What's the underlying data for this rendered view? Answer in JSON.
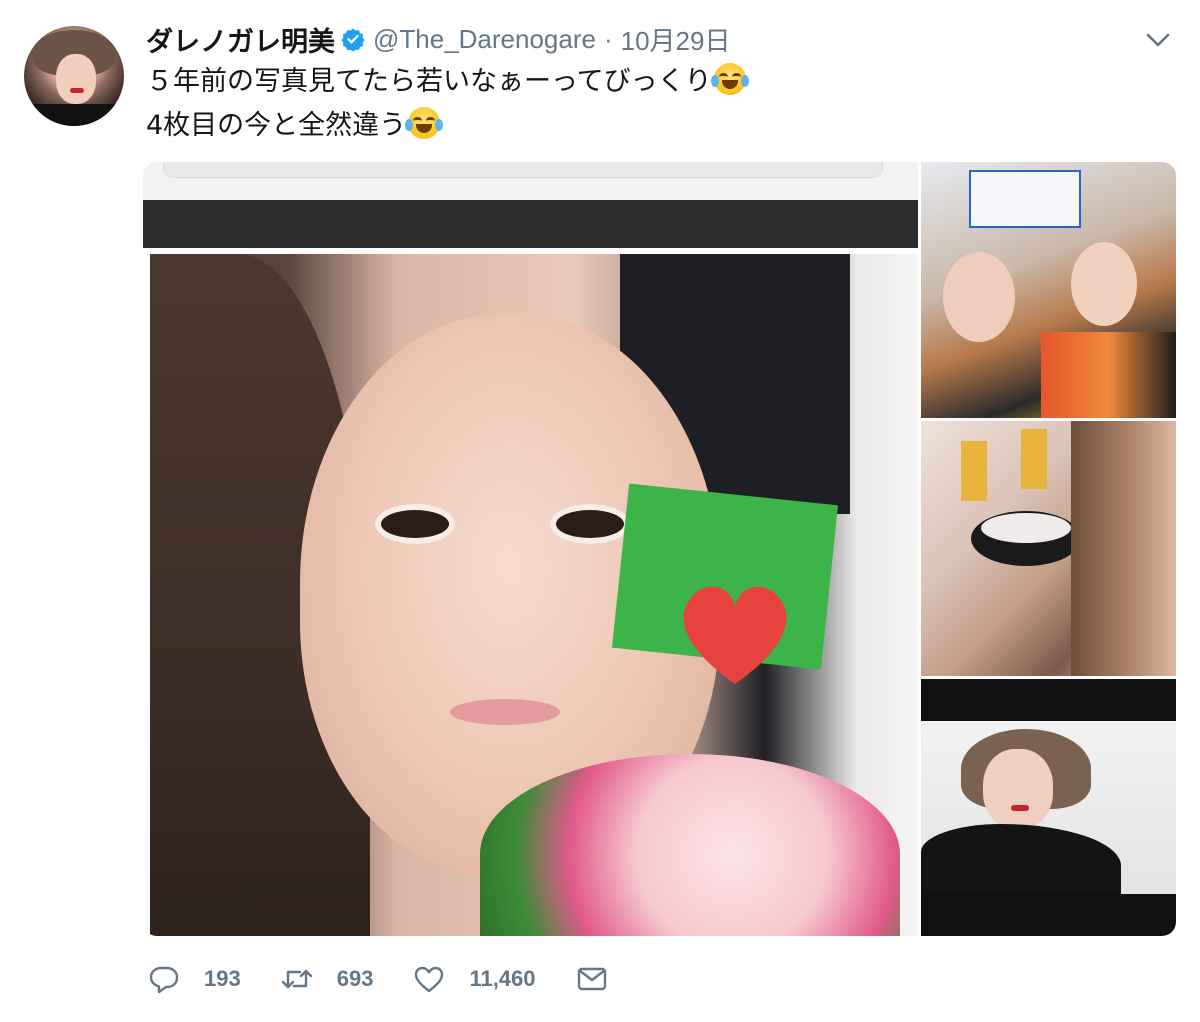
{
  "tweet": {
    "display_name": "ダレノガレ明美",
    "handle": "@The_Darenogare",
    "separator": "·",
    "date": "10月29日",
    "lines": [
      "５年前の写真見てたら若いなぁーってびっくり",
      "4枚目の今と全然違う"
    ],
    "emoji_name": "face-with-tears-of-joy"
  },
  "actions": {
    "reply_count": "193",
    "retweet_count": "693",
    "like_count": "11,460"
  },
  "colors": {
    "verified": "#1da1f2",
    "secondary_text": "#657786",
    "primary_text": "#14171a"
  }
}
